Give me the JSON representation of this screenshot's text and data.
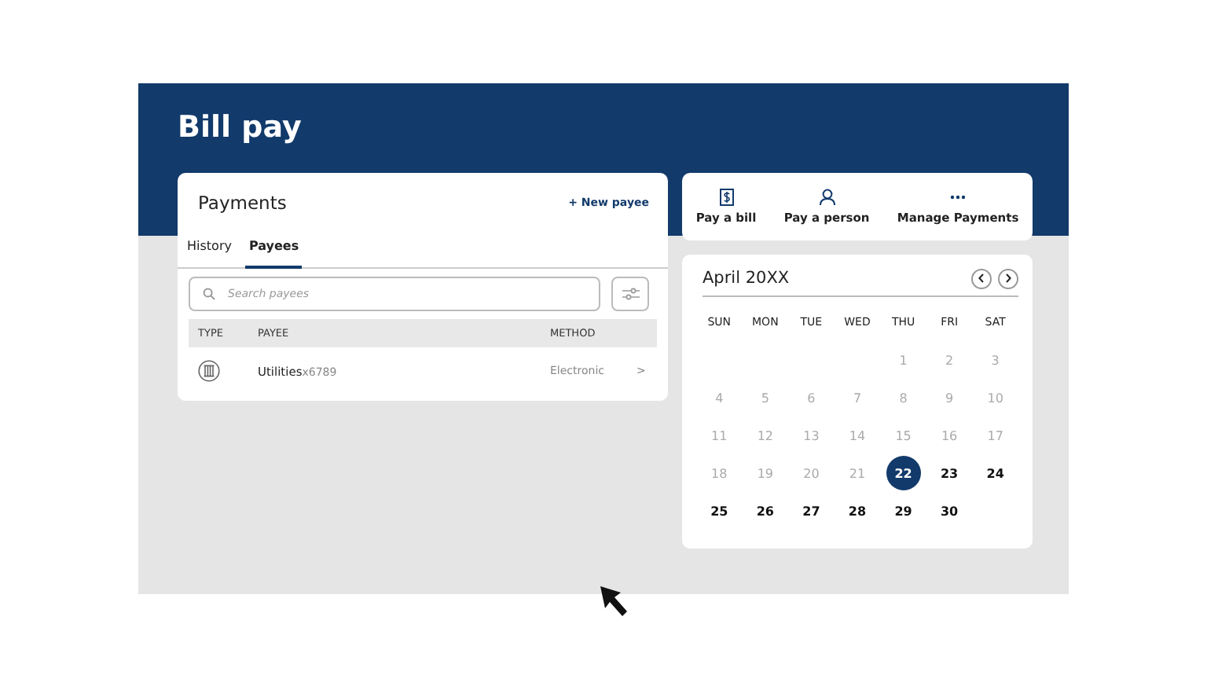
{
  "header": {
    "title": "Bill pay"
  },
  "payments": {
    "title": "Payments",
    "new_payee": "+ New payee",
    "tabs": [
      {
        "label": "History",
        "selected": false
      },
      {
        "label": "Payees",
        "selected": true
      }
    ],
    "search": {
      "placeholder": "Search payees"
    },
    "columns": [
      "TYPE",
      "PAYEE",
      "METHOD"
    ],
    "rows": [
      {
        "payee": "Utilities",
        "account": "x6789",
        "method": "Electronic",
        "chevron": ">"
      }
    ]
  },
  "actions": [
    {
      "kind": "bill",
      "label": "Pay a bill"
    },
    {
      "kind": "person",
      "label": "Pay a person"
    },
    {
      "kind": "more",
      "label": "Manage Payments"
    }
  ],
  "calendar": {
    "month": "April 20XX",
    "weekdays": [
      "SUN",
      "MON",
      "TUE",
      "WED",
      "THU",
      "FRI",
      "SAT"
    ],
    "days": [
      {
        "kind": "blank"
      },
      {
        "kind": "blank"
      },
      {
        "kind": "blank"
      },
      {
        "kind": "blank"
      },
      {
        "kind": "day",
        "label": "1",
        "disabled": true,
        "selected": false
      },
      {
        "kind": "day",
        "label": "2",
        "disabled": true,
        "selected": false
      },
      {
        "kind": "day",
        "label": "3",
        "disabled": true,
        "selected": false
      },
      {
        "kind": "day",
        "label": "4",
        "disabled": true,
        "selected": false
      },
      {
        "kind": "day",
        "label": "5",
        "disabled": true,
        "selected": false
      },
      {
        "kind": "day",
        "label": "6",
        "disabled": true,
        "selected": false
      },
      {
        "kind": "day",
        "label": "7",
        "disabled": true,
        "selected": false
      },
      {
        "kind": "day",
        "label": "8",
        "disabled": true,
        "selected": false
      },
      {
        "kind": "day",
        "label": "9",
        "disabled": true,
        "selected": false
      },
      {
        "kind": "day",
        "label": "10",
        "disabled": true,
        "selected": false
      },
      {
        "kind": "day",
        "label": "11",
        "disabled": true,
        "selected": false
      },
      {
        "kind": "day",
        "label": "12",
        "disabled": true,
        "selected": false
      },
      {
        "kind": "day",
        "label": "13",
        "disabled": true,
        "selected": false
      },
      {
        "kind": "day",
        "label": "14",
        "disabled": true,
        "selected": false
      },
      {
        "kind": "day",
        "label": "15",
        "disabled": true,
        "selected": false
      },
      {
        "kind": "day",
        "label": "16",
        "disabled": true,
        "selected": false
      },
      {
        "kind": "day",
        "label": "17",
        "disabled": true,
        "selected": false
      },
      {
        "kind": "day",
        "label": "18",
        "disabled": true,
        "selected": false
      },
      {
        "kind": "day",
        "label": "19",
        "disabled": true,
        "selected": false
      },
      {
        "kind": "day",
        "label": "20",
        "disabled": true,
        "selected": false
      },
      {
        "kind": "day",
        "label": "21",
        "disabled": true,
        "selected": false
      },
      {
        "kind": "day",
        "label": "22",
        "disabled": false,
        "selected": true
      },
      {
        "kind": "day",
        "label": "23",
        "disabled": false,
        "selected": false
      },
      {
        "kind": "day",
        "label": "24",
        "disabled": false,
        "selected": false
      },
      {
        "kind": "day",
        "label": "25",
        "disabled": false,
        "selected": false
      },
      {
        "kind": "day",
        "label": "26",
        "disabled": false,
        "selected": false
      },
      {
        "kind": "day",
        "label": "27",
        "disabled": false,
        "selected": false
      },
      {
        "kind": "day",
        "label": "28",
        "disabled": false,
        "selected": false
      },
      {
        "kind": "day",
        "label": "29",
        "disabled": false,
        "selected": false
      },
      {
        "kind": "day",
        "label": "30",
        "disabled": false,
        "selected": false
      }
    ]
  }
}
